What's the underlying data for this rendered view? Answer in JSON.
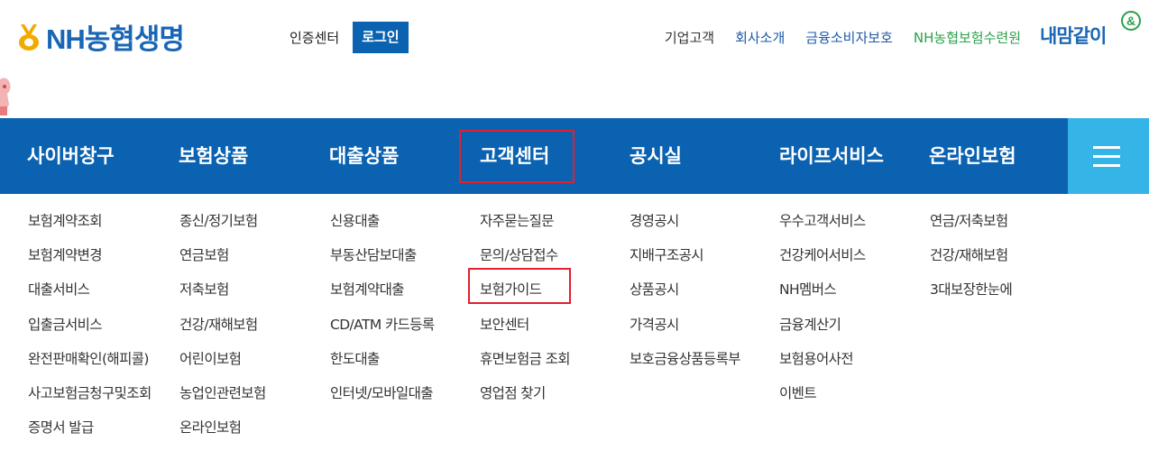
{
  "brand": {
    "logo_text": "NH농협생명",
    "sub_brand": "내맘같이",
    "colors": {
      "primary": "#0a62b1",
      "accent": "#35b4e8",
      "green": "#2aa04a",
      "highlight": "#e2202e"
    }
  },
  "util": {
    "cert_label": "인증센터",
    "login_label": "로그인",
    "links": [
      "기업고객",
      "회사소개",
      "금융소비자보호",
      "NH농협보험수련원"
    ]
  },
  "gnb": {
    "items": [
      "사이버창구",
      "보험상품",
      "대출상품",
      "고객센터",
      "공시실",
      "라이프서비스",
      "온라인보험"
    ],
    "selected": "고객센터",
    "menu_icon": "hamburger-icon"
  },
  "submenu": {
    "columns": [
      [
        "보험계약조회",
        "보험계약변경",
        "대출서비스",
        "입출금서비스",
        "완전판매확인(해피콜)",
        "사고보험금청구및조회",
        "증명서 발급"
      ],
      [
        "종신/정기보험",
        "연금보험",
        "저축보험",
        "건강/재해보험",
        "어린이보험",
        "농업인관련보험",
        "온라인보험"
      ],
      [
        "신용대출",
        "부동산담보대출",
        "보험계약대출",
        "CD/ATM 카드등록",
        "한도대출",
        "인터넷/모바일대출"
      ],
      [
        "자주묻는질문",
        "문의/상담접수",
        "보험가이드",
        "보안센터",
        "휴면보험금 조회",
        "영업점 찾기"
      ],
      [
        "경영공시",
        "지배구조공시",
        "상품공시",
        "가격공시",
        "보호금융상품등록부"
      ],
      [
        "우수고객서비스",
        "건강케어서비스",
        "NH멤버스",
        "금융계산기",
        "보험용어사전",
        "이벤트"
      ],
      [
        "연금/저축보험",
        "건강/재해보험",
        "3대보장한눈에"
      ]
    ],
    "highlighted": "보험가이드"
  }
}
